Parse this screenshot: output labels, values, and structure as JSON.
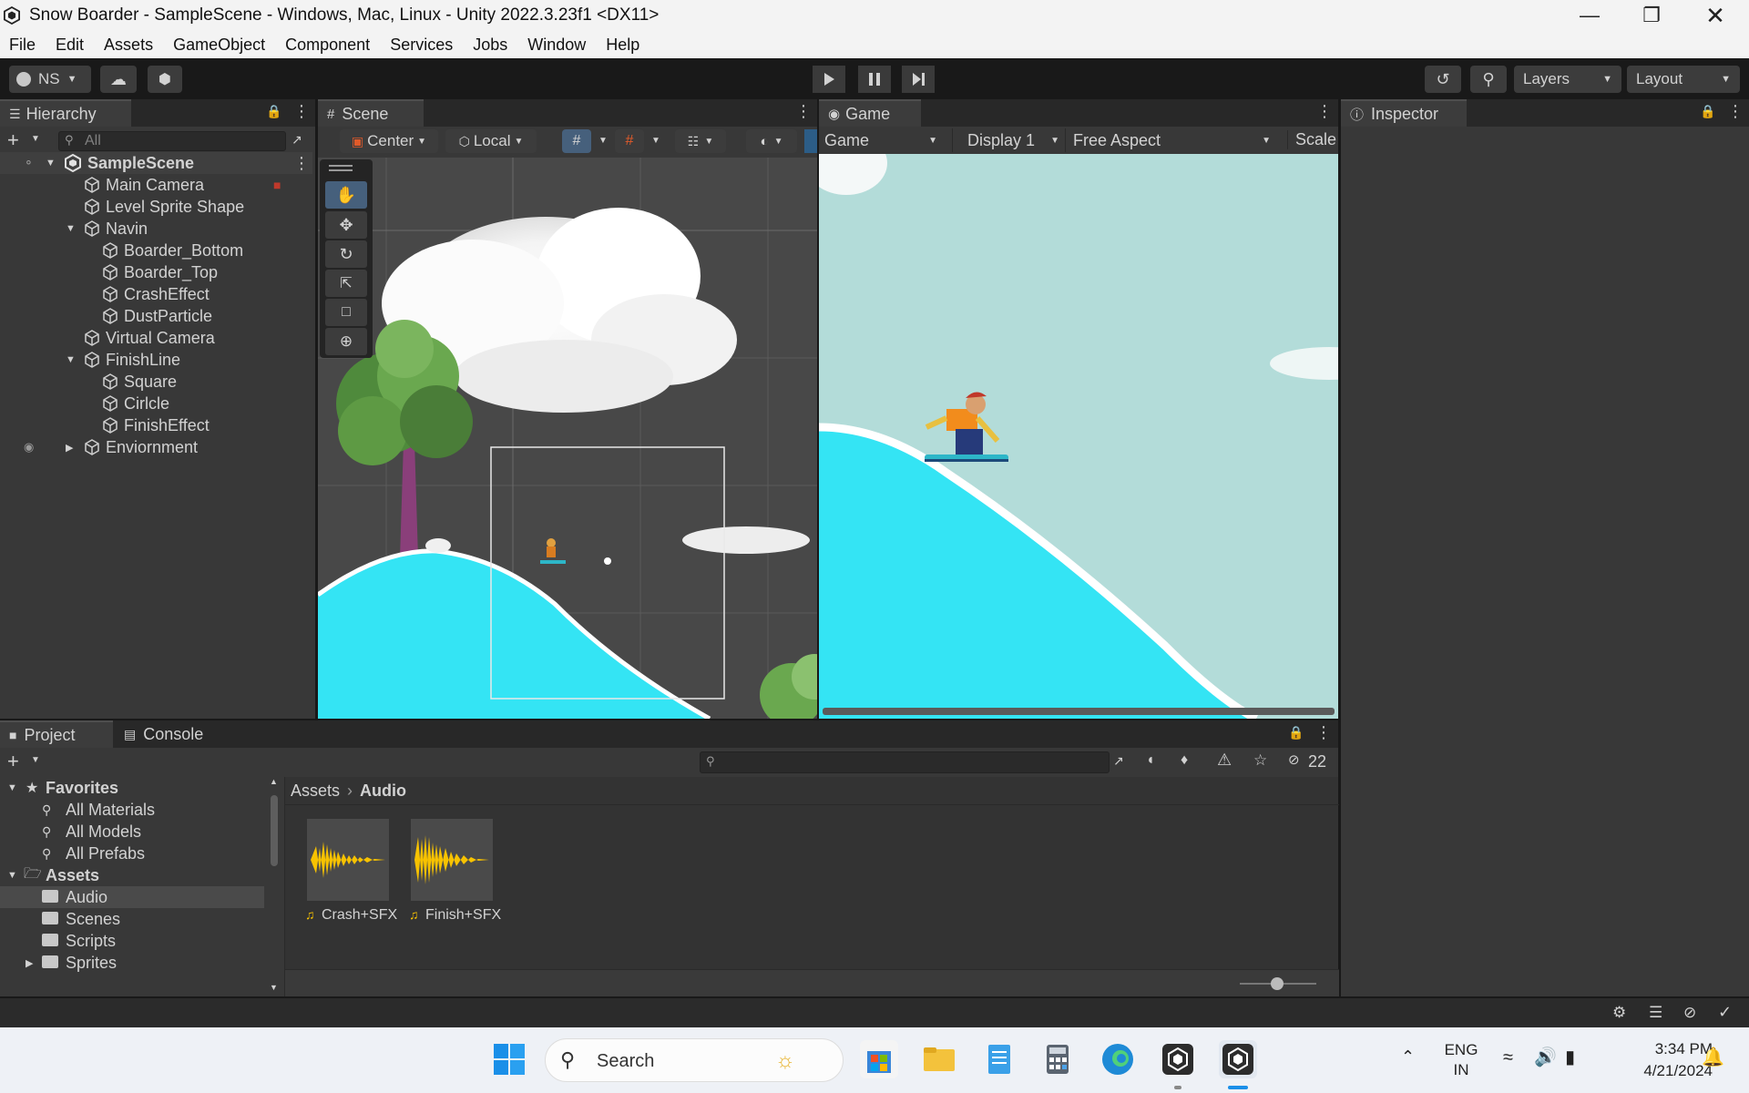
{
  "window": {
    "title": "Snow Boarder - SampleScene - Windows, Mac, Linux - Unity 2022.3.23f1 <DX11>"
  },
  "menu": [
    "File",
    "Edit",
    "Assets",
    "GameObject",
    "Component",
    "Services",
    "Jobs",
    "Window",
    "Help"
  ],
  "toolbar": {
    "account": "NS",
    "layers": "Layers",
    "layout": "Layout"
  },
  "hierarchy": {
    "tab": "Hierarchy",
    "search_placeholder": "All",
    "scene": "SampleScene",
    "items": [
      {
        "label": "Main Camera"
      },
      {
        "label": "Level Sprite Shape"
      },
      {
        "label": "Navin"
      },
      {
        "label": "Boarder_Bottom"
      },
      {
        "label": "Boarder_Top"
      },
      {
        "label": "CrashEffect"
      },
      {
        "label": "DustParticle"
      },
      {
        "label": "Virtual Camera"
      },
      {
        "label": "FinishLine"
      },
      {
        "label": "Square"
      },
      {
        "label": "Cirlcle"
      },
      {
        "label": "FinishEffect"
      },
      {
        "label": "Enviornment"
      }
    ]
  },
  "scene": {
    "tab": "Scene",
    "pivot": "Center",
    "space": "Local"
  },
  "game": {
    "tab": "Game",
    "mode": "Game",
    "display": "Display 1",
    "aspect": "Free Aspect",
    "scale": "Scale"
  },
  "inspector": {
    "tab": "Inspector"
  },
  "project": {
    "tab_project": "Project",
    "tab_console": "Console",
    "hidden_count": "22",
    "favorites": {
      "label": "Favorites",
      "items": [
        "All Materials",
        "All Models",
        "All Prefabs"
      ]
    },
    "assets": {
      "label": "Assets",
      "folders": [
        "Audio",
        "Scenes",
        "Scripts",
        "Sprites"
      ]
    },
    "breadcrumb": [
      "Assets",
      "Audio"
    ],
    "files": [
      "Crash+SFX",
      "Finish+SFX"
    ]
  },
  "taskbar": {
    "search": "Search",
    "lang1": "ENG",
    "lang2": "IN",
    "time": "3:34 PM",
    "date": "4/21/2024"
  },
  "colors": {
    "accent": "#2c5d87",
    "snow_slope": "#34e4f4",
    "game_sky": "#b3dcd9",
    "panel_bg": "#383838"
  }
}
